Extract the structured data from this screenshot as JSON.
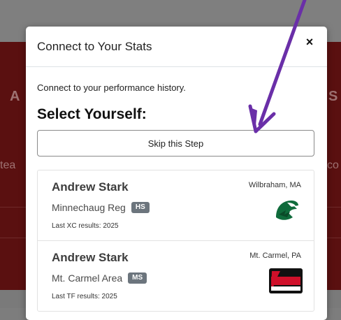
{
  "background": {
    "fragment_left_top": "A",
    "fragment_right_top": "S",
    "fragment_left_mid": "tea",
    "fragment_right_mid": "co"
  },
  "modal": {
    "title": "Connect to Your Stats",
    "close_label": "×",
    "intro": "Connect to your performance history.",
    "heading": "Select Yourself:",
    "skip_label": "Skip this Step"
  },
  "results": [
    {
      "name": "Andrew Stark",
      "school": "Minnechaug Reg",
      "level": "HS",
      "last_results": "Last XC results: 2025",
      "location": "Wilbraham, MA",
      "logo_icon": "falcon-logo-icon"
    },
    {
      "name": "Andrew Stark",
      "school": "Mt. Carmel Area",
      "level": "MS",
      "last_results": "Last TF results: 2025",
      "location": "Mt. Carmel, PA",
      "logo_icon": "tornadoes-logo-icon"
    }
  ],
  "colors": {
    "annotation_arrow": "#6a2fa8",
    "background_band": "#5a1010",
    "badge": "#6c757d"
  }
}
